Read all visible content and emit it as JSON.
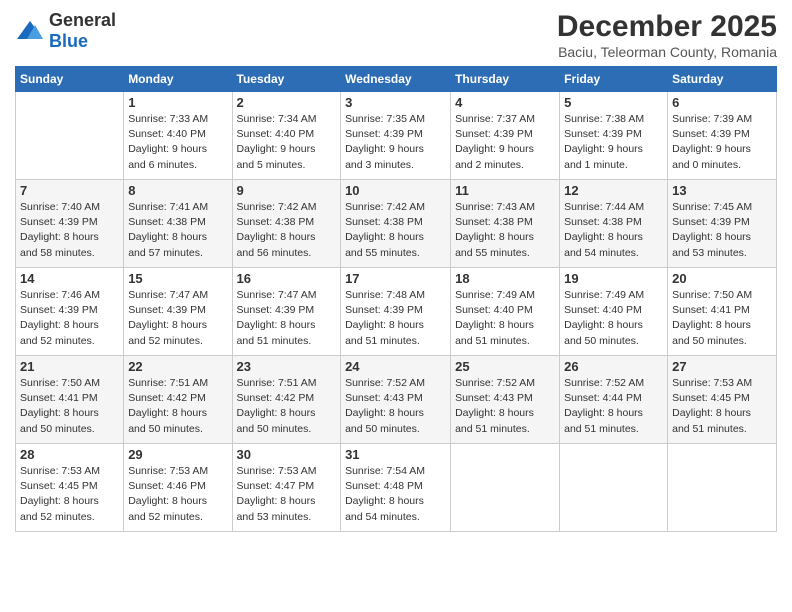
{
  "logo": {
    "general": "General",
    "blue": "Blue"
  },
  "title": "December 2025",
  "subtitle": "Baciu, Teleorman County, Romania",
  "days_header": [
    "Sunday",
    "Monday",
    "Tuesday",
    "Wednesday",
    "Thursday",
    "Friday",
    "Saturday"
  ],
  "weeks": [
    [
      {
        "day": "",
        "info": ""
      },
      {
        "day": "1",
        "info": "Sunrise: 7:33 AM\nSunset: 4:40 PM\nDaylight: 9 hours\nand 6 minutes."
      },
      {
        "day": "2",
        "info": "Sunrise: 7:34 AM\nSunset: 4:40 PM\nDaylight: 9 hours\nand 5 minutes."
      },
      {
        "day": "3",
        "info": "Sunrise: 7:35 AM\nSunset: 4:39 PM\nDaylight: 9 hours\nand 3 minutes."
      },
      {
        "day": "4",
        "info": "Sunrise: 7:37 AM\nSunset: 4:39 PM\nDaylight: 9 hours\nand 2 minutes."
      },
      {
        "day": "5",
        "info": "Sunrise: 7:38 AM\nSunset: 4:39 PM\nDaylight: 9 hours\nand 1 minute."
      },
      {
        "day": "6",
        "info": "Sunrise: 7:39 AM\nSunset: 4:39 PM\nDaylight: 9 hours\nand 0 minutes."
      }
    ],
    [
      {
        "day": "7",
        "info": "Sunrise: 7:40 AM\nSunset: 4:39 PM\nDaylight: 8 hours\nand 58 minutes."
      },
      {
        "day": "8",
        "info": "Sunrise: 7:41 AM\nSunset: 4:38 PM\nDaylight: 8 hours\nand 57 minutes."
      },
      {
        "day": "9",
        "info": "Sunrise: 7:42 AM\nSunset: 4:38 PM\nDaylight: 8 hours\nand 56 minutes."
      },
      {
        "day": "10",
        "info": "Sunrise: 7:42 AM\nSunset: 4:38 PM\nDaylight: 8 hours\nand 55 minutes."
      },
      {
        "day": "11",
        "info": "Sunrise: 7:43 AM\nSunset: 4:38 PM\nDaylight: 8 hours\nand 55 minutes."
      },
      {
        "day": "12",
        "info": "Sunrise: 7:44 AM\nSunset: 4:38 PM\nDaylight: 8 hours\nand 54 minutes."
      },
      {
        "day": "13",
        "info": "Sunrise: 7:45 AM\nSunset: 4:39 PM\nDaylight: 8 hours\nand 53 minutes."
      }
    ],
    [
      {
        "day": "14",
        "info": "Sunrise: 7:46 AM\nSunset: 4:39 PM\nDaylight: 8 hours\nand 52 minutes."
      },
      {
        "day": "15",
        "info": "Sunrise: 7:47 AM\nSunset: 4:39 PM\nDaylight: 8 hours\nand 52 minutes."
      },
      {
        "day": "16",
        "info": "Sunrise: 7:47 AM\nSunset: 4:39 PM\nDaylight: 8 hours\nand 51 minutes."
      },
      {
        "day": "17",
        "info": "Sunrise: 7:48 AM\nSunset: 4:39 PM\nDaylight: 8 hours\nand 51 minutes."
      },
      {
        "day": "18",
        "info": "Sunrise: 7:49 AM\nSunset: 4:40 PM\nDaylight: 8 hours\nand 51 minutes."
      },
      {
        "day": "19",
        "info": "Sunrise: 7:49 AM\nSunset: 4:40 PM\nDaylight: 8 hours\nand 50 minutes."
      },
      {
        "day": "20",
        "info": "Sunrise: 7:50 AM\nSunset: 4:41 PM\nDaylight: 8 hours\nand 50 minutes."
      }
    ],
    [
      {
        "day": "21",
        "info": "Sunrise: 7:50 AM\nSunset: 4:41 PM\nDaylight: 8 hours\nand 50 minutes."
      },
      {
        "day": "22",
        "info": "Sunrise: 7:51 AM\nSunset: 4:42 PM\nDaylight: 8 hours\nand 50 minutes."
      },
      {
        "day": "23",
        "info": "Sunrise: 7:51 AM\nSunset: 4:42 PM\nDaylight: 8 hours\nand 50 minutes."
      },
      {
        "day": "24",
        "info": "Sunrise: 7:52 AM\nSunset: 4:43 PM\nDaylight: 8 hours\nand 50 minutes."
      },
      {
        "day": "25",
        "info": "Sunrise: 7:52 AM\nSunset: 4:43 PM\nDaylight: 8 hours\nand 51 minutes."
      },
      {
        "day": "26",
        "info": "Sunrise: 7:52 AM\nSunset: 4:44 PM\nDaylight: 8 hours\nand 51 minutes."
      },
      {
        "day": "27",
        "info": "Sunrise: 7:53 AM\nSunset: 4:45 PM\nDaylight: 8 hours\nand 51 minutes."
      }
    ],
    [
      {
        "day": "28",
        "info": "Sunrise: 7:53 AM\nSunset: 4:45 PM\nDaylight: 8 hours\nand 52 minutes."
      },
      {
        "day": "29",
        "info": "Sunrise: 7:53 AM\nSunset: 4:46 PM\nDaylight: 8 hours\nand 52 minutes."
      },
      {
        "day": "30",
        "info": "Sunrise: 7:53 AM\nSunset: 4:47 PM\nDaylight: 8 hours\nand 53 minutes."
      },
      {
        "day": "31",
        "info": "Sunrise: 7:54 AM\nSunset: 4:48 PM\nDaylight: 8 hours\nand 54 minutes."
      },
      {
        "day": "",
        "info": ""
      },
      {
        "day": "",
        "info": ""
      },
      {
        "day": "",
        "info": ""
      }
    ]
  ]
}
